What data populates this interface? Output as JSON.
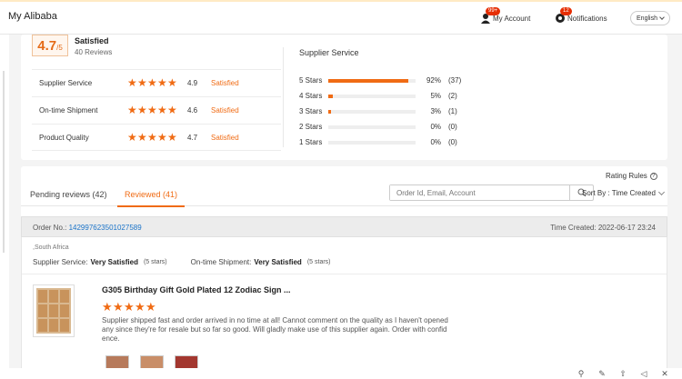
{
  "header": {
    "brand": "My Alibaba",
    "account_badge": "99+",
    "account_label": "My Account",
    "notifications_badge": "12",
    "notifications_label": "Notifications",
    "language": "English"
  },
  "summary": {
    "score": "4.7",
    "score_max": "/5",
    "overall_word": "Satisfied",
    "review_count": "40 Reviews",
    "metrics": [
      {
        "label": "Supplier Service",
        "value": "4.9",
        "status": "Satisfied"
      },
      {
        "label": "On-time Shipment",
        "value": "4.6",
        "status": "Satisfied"
      },
      {
        "label": "Product Quality",
        "value": "4.7",
        "status": "Satisfied"
      }
    ],
    "distribution_title": "Supplier Service",
    "distribution": [
      {
        "label": "5 Stars",
        "percent": "92%",
        "count": "(37)",
        "fraction": 0.92
      },
      {
        "label": "4 Stars",
        "percent": "5%",
        "count": "(2)",
        "fraction": 0.05
      },
      {
        "label": "3 Stars",
        "percent": "3%",
        "count": "(1)",
        "fraction": 0.03
      },
      {
        "label": "2 Stars",
        "percent": "0%",
        "count": "(0)",
        "fraction": 0
      },
      {
        "label": "1 Stars",
        "percent": "0%",
        "count": "(0)",
        "fraction": 0
      }
    ]
  },
  "reviews": {
    "rating_rules": "Rating Rules",
    "tabs": [
      {
        "label": "Pending reviews (42)",
        "active": false
      },
      {
        "label": "Reviewed (41)",
        "active": true
      }
    ],
    "search_placeholder": "Order Id, Email, Account",
    "sort_label": "Sort By : Time Created",
    "order": {
      "order_no_label": "Order No.:",
      "order_no": "142997623501027589",
      "time_created": "Time Created: 2022-06-17 23:24",
      "country": ",South Africa",
      "supplier_service_label": "Supplier Service:",
      "supplier_service_value": "Very Satisfied",
      "supplier_service_stars": "(5 stars)",
      "shipment_label": "On-time Shipment:",
      "shipment_value": "Very Satisfied",
      "shipment_stars": "(5 stars)",
      "product_title": "G305 Birthday Gift Gold Plated 12 Zodiac Sign ...",
      "rating": 5,
      "review_text": "Supplier shipped fast and order arrived in no time at all! Cannot comment on the quality as I haven't opened any since they're for resale but so far so good. Will gladly make use of this supplier again. Order with confid ence."
    }
  },
  "colors": {
    "accent": "#f06b14",
    "link": "#1a73c8",
    "badge": "#e62e04"
  }
}
